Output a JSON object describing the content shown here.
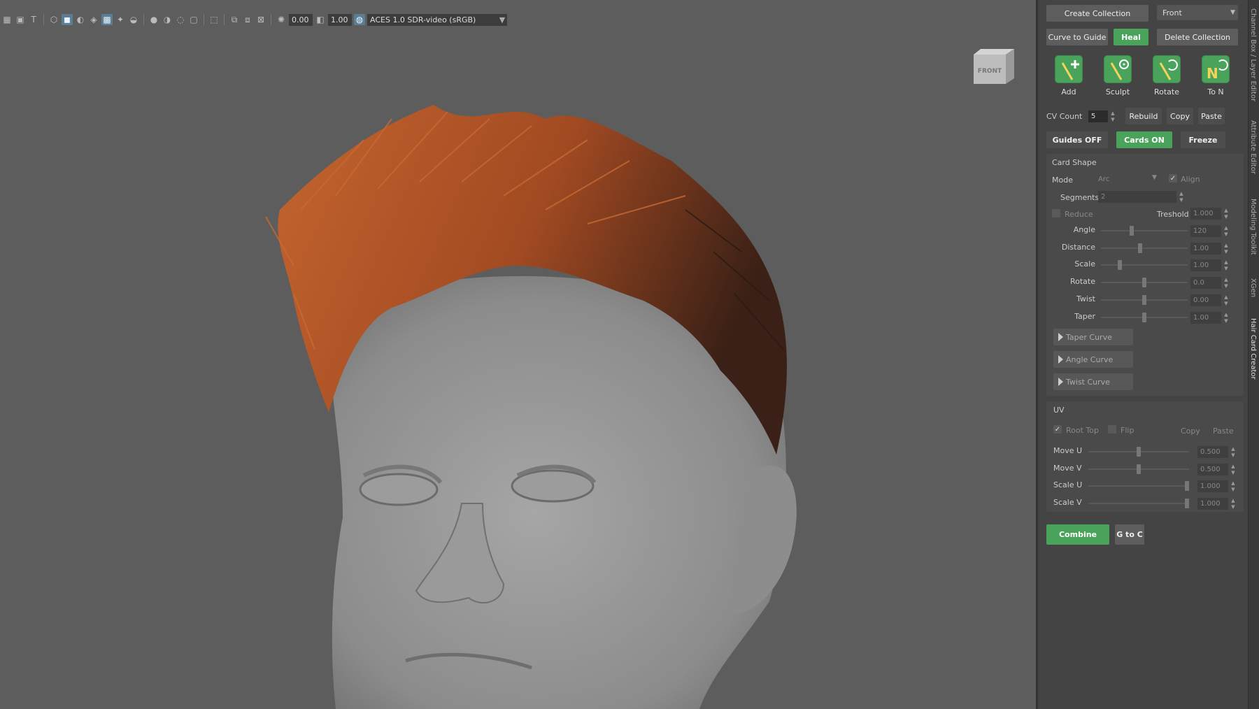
{
  "toolbar": {
    "icons": [
      "grid-icon",
      "image-plane-icon",
      "text-icon",
      "wireframe-cube-icon",
      "shaded-cube-icon",
      "smooth-shade-icon",
      "wireframe-on-shaded-icon",
      "textured-icon",
      "lights-icon",
      "shadows-icon",
      "ambient-occlusion-icon",
      "motion-blur-icon",
      "anti-alias-icon",
      "depth-of-field-icon",
      "isolate-select-icon",
      "xray-icon",
      "xray-joints-icon",
      "xray-components-icon"
    ],
    "exposure_value": "0.00",
    "gamma_value": "1.00",
    "color_space": "ACES 1.0 SDR-video (sRGB)"
  },
  "viewcube": {
    "label": "FRONT"
  },
  "panel": {
    "create_collection": "Create Collection",
    "view_dropdown": "Front",
    "curve_to_guide": "Curve to Guide",
    "heal": "Heal",
    "delete_collection": "Delete Collection",
    "tools": [
      {
        "label": "Add",
        "icon": "add-icon"
      },
      {
        "label": "Sculpt",
        "icon": "sculpt-icon"
      },
      {
        "label": "Rotate",
        "icon": "rotate-icon"
      },
      {
        "label": "To N",
        "icon": "to-n-icon"
      }
    ],
    "cv_count_label": "CV Count",
    "cv_count_value": "5",
    "rebuild": "Rebuild",
    "copy": "Copy",
    "paste": "Paste",
    "guides_off": "Guides OFF",
    "cards_on": "Cards ON",
    "freeze": "Freeze",
    "card_shape": {
      "title": "Card Shape",
      "mode_label": "Mode",
      "mode_value": "Arc",
      "align_label": "Align",
      "align_checked": true,
      "segments_label": "Segments",
      "segments_value": "2",
      "reduce_label": "Reduce",
      "reduce_checked": false,
      "treshold_label": "Treshold",
      "treshold_value": "1.000",
      "sliders": [
        {
          "label": "Angle",
          "value": "120",
          "pos": 0.35
        },
        {
          "label": "Distance",
          "value": "1.00",
          "pos": 0.45
        },
        {
          "label": "Scale",
          "value": "1.00",
          "pos": 0.2
        },
        {
          "label": "Rotate",
          "value": "0.0",
          "pos": 0.5
        },
        {
          "label": "Twist",
          "value": "0.00",
          "pos": 0.5
        },
        {
          "label": "Taper",
          "value": "1.00",
          "pos": 0.5
        }
      ],
      "curves": [
        "Taper Curve",
        "Angle Curve",
        "Twist Curve"
      ]
    },
    "uv": {
      "title": "UV",
      "root_top_label": "Root Top",
      "root_top_checked": true,
      "flip_label": "Flip",
      "flip_checked": false,
      "copy": "Copy",
      "paste": "Paste",
      "sliders": [
        {
          "label": "Move U",
          "value": "0.500",
          "pos": 0.5
        },
        {
          "label": "Move V",
          "value": "0.500",
          "pos": 0.5
        },
        {
          "label": "Scale U",
          "value": "1.000",
          "pos": 1.0
        },
        {
          "label": "Scale V",
          "value": "1.000",
          "pos": 1.0
        }
      ]
    },
    "combine": "Combine",
    "g_to_c": "G to C"
  },
  "side_tabs": [
    "Channel Box / Layer Editor",
    "Attribute Editor",
    "Modeling Toolkit",
    "XGen",
    "Hair Card Creator"
  ],
  "colors": {
    "accent_green": "#4aa35b",
    "viewport_bg": "#5d5d5d",
    "panel_bg": "#444444",
    "hair": "#b85a2c"
  }
}
